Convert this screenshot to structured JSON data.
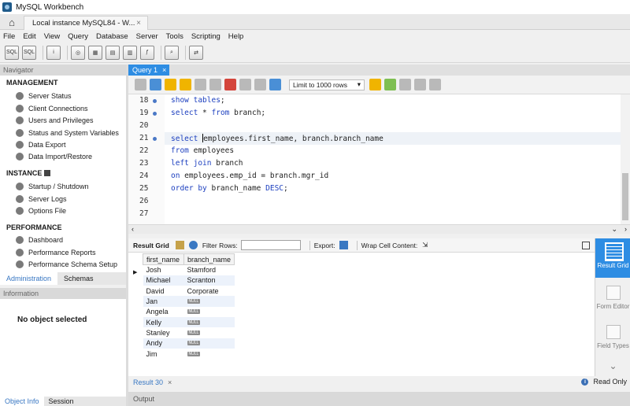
{
  "window": {
    "title": "MySQL Workbench"
  },
  "tabs": {
    "connection_tab": "Local instance MySQL84 - W...",
    "close": "×"
  },
  "menu": [
    "File",
    "Edit",
    "View",
    "Query",
    "Database",
    "Server",
    "Tools",
    "Scripting",
    "Help"
  ],
  "navigator": {
    "header": "Navigator",
    "management_title": "MANAGEMENT",
    "management_items": [
      "Server Status",
      "Client Connections",
      "Users and Privileges",
      "Status and System Variables",
      "Data Export",
      "Data Import/Restore"
    ],
    "instance_title": "INSTANCE",
    "instance_items": [
      "Startup / Shutdown",
      "Server Logs",
      "Options File"
    ],
    "performance_title": "PERFORMANCE",
    "performance_items": [
      "Dashboard",
      "Performance Reports",
      "Performance Schema Setup"
    ],
    "tabs": [
      "Administration",
      "Schemas"
    ]
  },
  "information": {
    "header": "Information",
    "empty_text": "No object selected",
    "tabs": [
      "Object Info",
      "Session"
    ]
  },
  "query": {
    "tab_label": "Query 1",
    "limit_label": "Limit to 1000 rows",
    "lines": [
      {
        "num": "18",
        "marker": true,
        "text": "show tables;"
      },
      {
        "num": "19",
        "marker": true,
        "text": "select * from branch;"
      },
      {
        "num": "20",
        "marker": false,
        "text": ""
      },
      {
        "num": "21",
        "marker": true,
        "text": "select employees.first_name, branch.branch_name"
      },
      {
        "num": "22",
        "marker": false,
        "text": "from employees"
      },
      {
        "num": "23",
        "marker": false,
        "text": "left join branch"
      },
      {
        "num": "24",
        "marker": false,
        "text": "on employees.emp_id = branch.mgr_id"
      },
      {
        "num": "25",
        "marker": false,
        "text": "order by branch_name DESC;"
      },
      {
        "num": "26",
        "marker": false,
        "text": ""
      },
      {
        "num": "27",
        "marker": false,
        "text": ""
      }
    ]
  },
  "result": {
    "toolbar": {
      "grid_label": "Result Grid",
      "filter_label": "Filter Rows:",
      "export_label": "Export:",
      "wrap_label": "Wrap Cell Content:"
    },
    "columns": [
      "first_name",
      "branch_name"
    ],
    "null_label": "NULL",
    "rows": [
      [
        "Josh",
        "Stamford"
      ],
      [
        "Michael",
        "Scranton"
      ],
      [
        "David",
        "Corporate"
      ],
      [
        "Jan",
        null
      ],
      [
        "Angela",
        null
      ],
      [
        "Kelly",
        null
      ],
      [
        "Stanley",
        null
      ],
      [
        "Andy",
        null
      ],
      [
        "Jim",
        null
      ]
    ],
    "side_panel": [
      "Result Grid",
      "Form Editor",
      "Field Types"
    ],
    "tab_label": "Result 30",
    "read_only": "Read Only"
  },
  "output": {
    "header": "Output"
  }
}
